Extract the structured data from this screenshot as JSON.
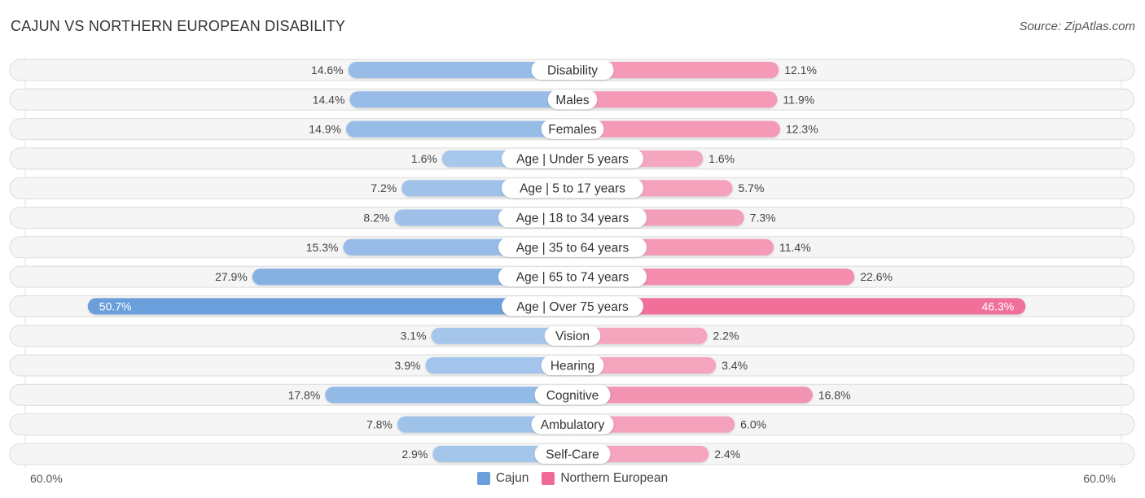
{
  "header": {
    "title": "CAJUN VS NORTHERN EUROPEAN DISABILITY",
    "source": "Source: ZipAtlas.com"
  },
  "colors": {
    "cajun": "#6a9fdb",
    "cajun_light": "#a9c8ec",
    "northern_european": "#f06a95",
    "northern_european_light": "#f5a8c0"
  },
  "chart_data": {
    "type": "bar",
    "orientation": "horizontal-diverging",
    "title": "CAJUN VS NORTHERN EUROPEAN DISABILITY",
    "categories": [
      "Disability",
      "Males",
      "Females",
      "Age | Under 5 years",
      "Age | 5 to 17 years",
      "Age | 18 to 34 years",
      "Age | 35 to 64 years",
      "Age | 65 to 74 years",
      "Age | Over 75 years",
      "Vision",
      "Hearing",
      "Cognitive",
      "Ambulatory",
      "Self-Care"
    ],
    "series": [
      {
        "name": "Cajun",
        "side": "left",
        "values": [
          14.6,
          14.4,
          14.9,
          1.6,
          7.2,
          8.2,
          15.3,
          27.9,
          50.7,
          3.1,
          3.9,
          17.8,
          7.8,
          2.9
        ],
        "labels": [
          "14.6%",
          "14.4%",
          "14.9%",
          "1.6%",
          "7.2%",
          "8.2%",
          "15.3%",
          "27.9%",
          "50.7%",
          "3.1%",
          "3.9%",
          "17.8%",
          "7.8%",
          "2.9%"
        ]
      },
      {
        "name": "Northern European",
        "side": "right",
        "values": [
          12.1,
          11.9,
          12.3,
          1.6,
          5.7,
          7.3,
          11.4,
          22.6,
          46.3,
          2.2,
          3.4,
          16.8,
          6.0,
          2.4
        ],
        "labels": [
          "12.1%",
          "11.9%",
          "12.3%",
          "1.6%",
          "5.7%",
          "7.3%",
          "11.4%",
          "22.6%",
          "46.3%",
          "2.2%",
          "3.4%",
          "16.8%",
          "6.0%",
          "2.4%"
        ]
      }
    ],
    "xlim": [
      0,
      60
    ],
    "axis_labels": {
      "left": "60.0%",
      "right": "60.0%"
    },
    "legend": {
      "position": "bottom-center",
      "entries": [
        "Cajun",
        "Northern European"
      ]
    },
    "unit": "%"
  }
}
